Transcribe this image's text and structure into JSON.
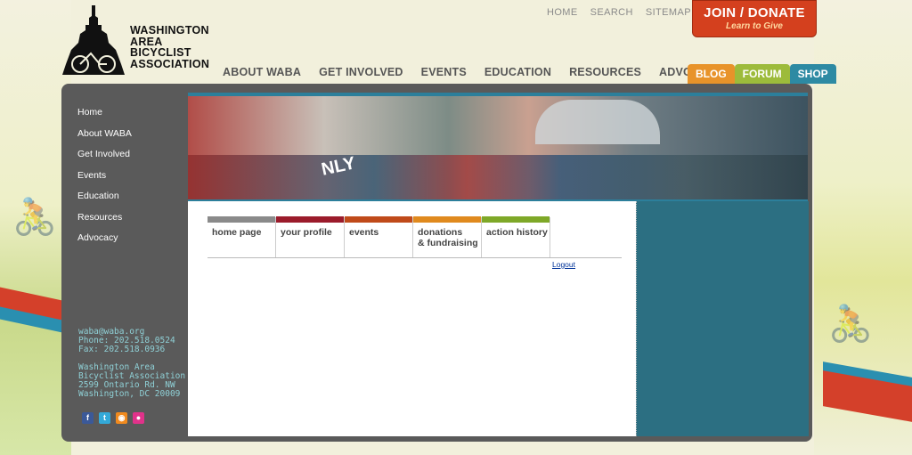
{
  "header": {
    "org_name": "WASHINGTON\nAREA\nBICYCLIST\nASSOCIATION",
    "top_links": [
      "HOME",
      "SEARCH",
      "SITEMAP"
    ],
    "donate_label": "JOIN / DONATE",
    "donate_tagline": "Learn to Give",
    "main_nav": [
      "ABOUT WABA",
      "GET INVOLVED",
      "EVENTS",
      "EDUCATION",
      "RESOURCES",
      "ADVOCACY"
    ],
    "pills": [
      {
        "label": "BLOG",
        "color": "#e8932a"
      },
      {
        "label": "FORUM",
        "color": "#9dbb3b"
      },
      {
        "label": "SHOP",
        "color": "#2d8aa3"
      }
    ]
  },
  "sidebar": {
    "nav": [
      "Home",
      "About WABA",
      "Get Involved",
      "Events",
      "Education",
      "Resources",
      "Advocacy"
    ],
    "contact": {
      "email": "waba@waba.org",
      "phone": "Phone: 202.518.0524",
      "fax": "Fax: 202.518.0936",
      "address": [
        "Washington Area",
        "Bicyclist Association",
        "2599 Ontario Rd. NW",
        "Washington, DC 20009"
      ]
    },
    "social_icons": [
      "facebook-icon",
      "twitter-icon",
      "rss-icon",
      "flickr-icon"
    ]
  },
  "banner": {
    "sign_text": "NLY"
  },
  "content": {
    "tabs": [
      {
        "label": "home page",
        "color": "#8a8a8a"
      },
      {
        "label": "your profile",
        "color": "#9b1b2b"
      },
      {
        "label": "events",
        "color": "#c04a1a"
      },
      {
        "label": "donations\n& fundraising",
        "color": "#e08a1e"
      },
      {
        "label": "action history",
        "color": "#7ea828"
      }
    ],
    "logout_label": "Logout"
  }
}
